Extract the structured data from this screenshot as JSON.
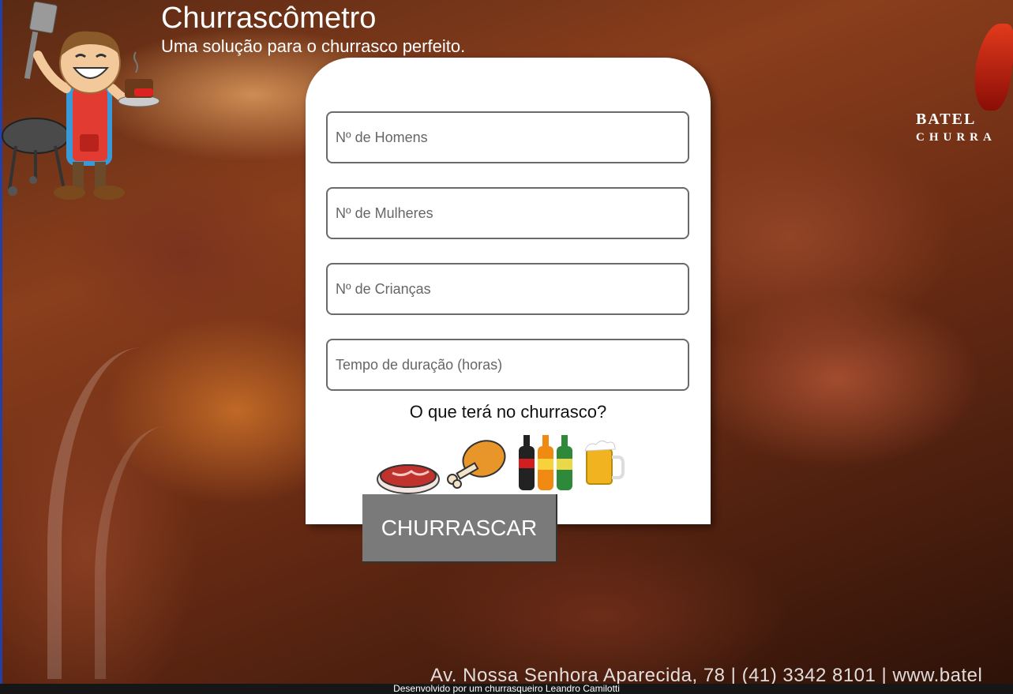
{
  "header": {
    "title": "Churrascômetro",
    "subtitle": "Uma solução para o churrasco perfeito."
  },
  "brand": {
    "name": "BATEL",
    "sub": "CHURRA",
    "address": "Av. Nossa Senhora Aparecida, 78 | (41) 3342 8101 | www.batel"
  },
  "form": {
    "fields": [
      {
        "placeholder": "Nº de Homens",
        "value": ""
      },
      {
        "placeholder": "Nº de Mulheres",
        "value": ""
      },
      {
        "placeholder": "Nº de Crianças",
        "value": ""
      },
      {
        "placeholder": "Tempo de duração (horas)",
        "value": ""
      }
    ],
    "question": "O que terá no churrasco?",
    "items": [
      {
        "icon": "beef-steak-icon"
      },
      {
        "icon": "chicken-leg-icon"
      },
      {
        "icon": "soda-bottles-icon"
      },
      {
        "icon": "beer-mug-icon"
      }
    ],
    "submit_label": "CHURRASCAR"
  },
  "footer": {
    "text": "Desenvolvido por um churrasqueiro Leandro Camilotti"
  },
  "colors": {
    "button_bg": "#7a7a7a",
    "card_bg": "#ffffff",
    "footer_bg": "#161616"
  }
}
